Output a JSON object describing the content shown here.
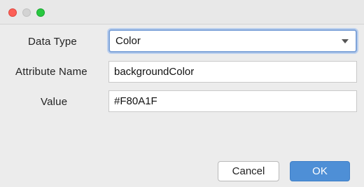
{
  "window": {
    "traffic_lights": {
      "close": "close-icon",
      "minimize": "minimize-icon",
      "maximize": "maximize-icon"
    }
  },
  "form": {
    "data_type_label": "Data Type",
    "data_type_value": "Color",
    "attribute_name_label": "Attribute Name",
    "attribute_name_value": "backgroundColor",
    "value_label": "Value",
    "value_value": "#F80A1F"
  },
  "buttons": {
    "cancel_label": "Cancel",
    "ok_label": "OK"
  },
  "colors": {
    "ok_button": "#4e8fd6",
    "focus_ring": "#7fa4d9",
    "close_light": "#fc5f57",
    "maximize_light": "#28c840"
  }
}
